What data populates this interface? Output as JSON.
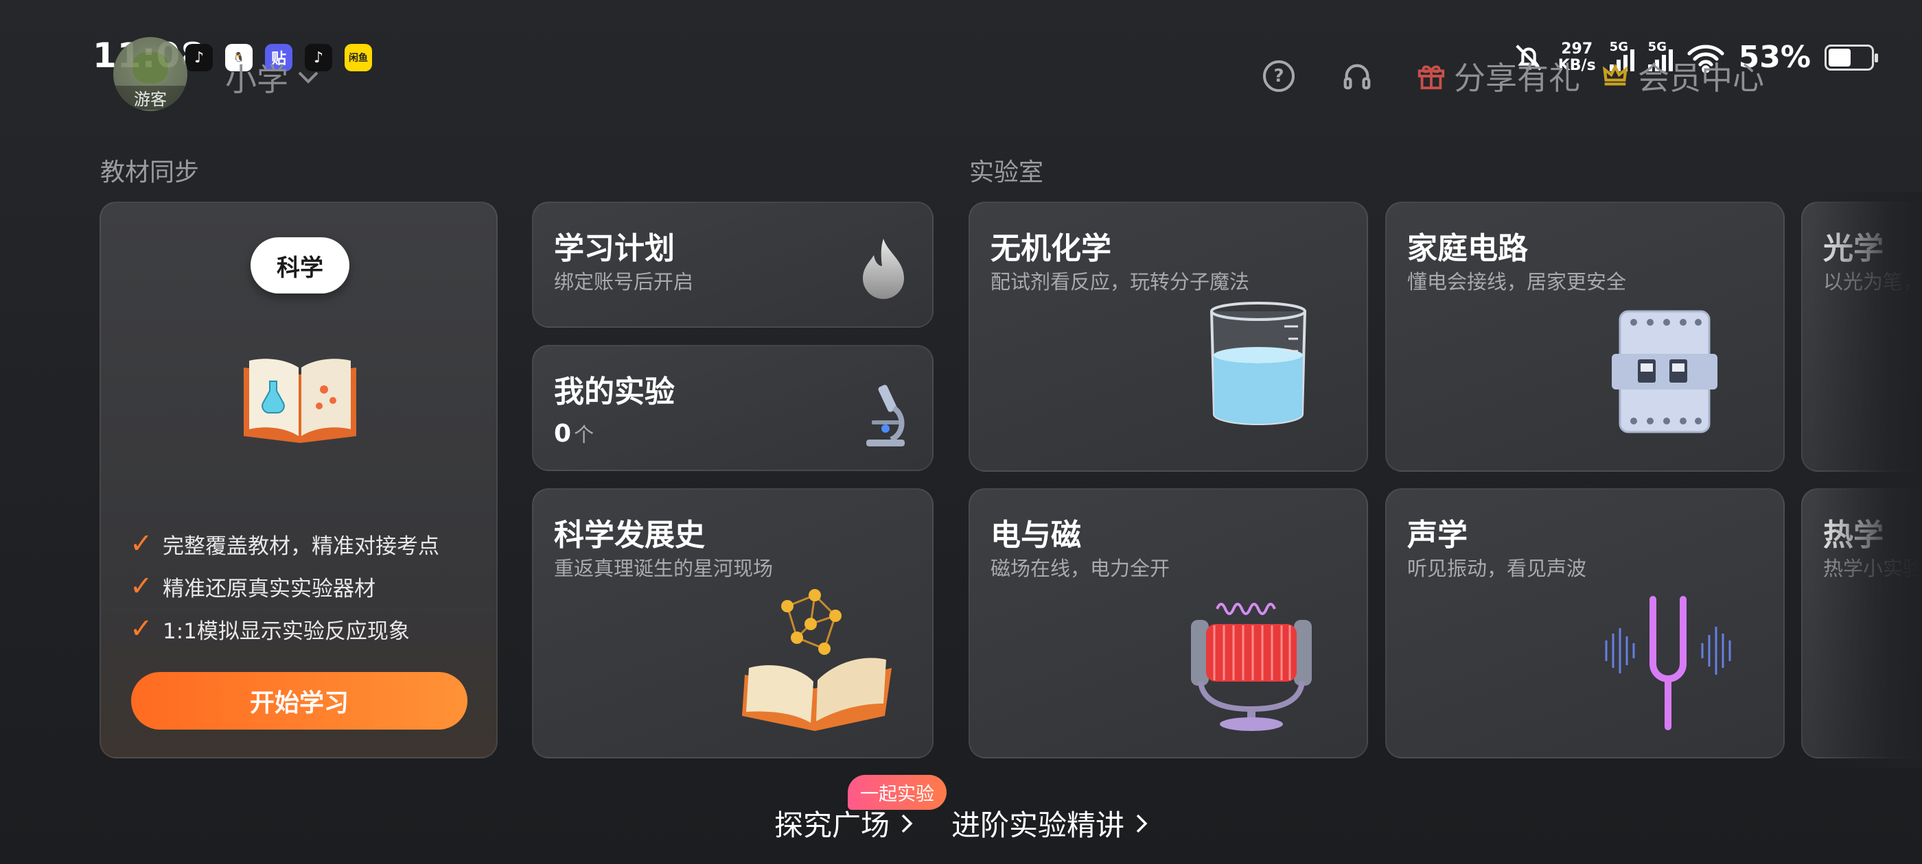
{
  "status_bar": {
    "time": "11:08",
    "apps": [
      {
        "name": "tiktok-icon",
        "glyph": "♪",
        "bg": "#111111",
        "fg": "#ffffff"
      },
      {
        "name": "qq-icon",
        "glyph": "🐧",
        "bg": "#ffffff",
        "fg": "#111111"
      },
      {
        "name": "tieba-icon",
        "glyph": "贴",
        "bg": "#5b5ff0",
        "fg": "#ffffff"
      },
      {
        "name": "tiktok-icon-2",
        "glyph": "♪",
        "bg": "#111111",
        "fg": "#ffffff"
      },
      {
        "name": "mini-app-icon",
        "glyph": "闲鱼",
        "bg": "#ffd900",
        "fg": "#222222"
      }
    ],
    "net_speed_value": "297",
    "net_speed_unit": "KB/s",
    "signal_1": "5G",
    "signal_2": "5G",
    "battery_percent": "53%",
    "battery_level": 0.53
  },
  "header": {
    "guest_label": "游客",
    "grade_label": "小学",
    "share_label": "分享有礼",
    "vip_label": "会员中心"
  },
  "sections": {
    "textbook_title": "教材同步",
    "lab_title": "实验室"
  },
  "textbook_card": {
    "subject": "科学",
    "features": [
      "完整覆盖教材，精准对接考点",
      "精准还原真实实验器材",
      "1:1模拟显示实验反应现象"
    ],
    "start_button": "开始学习"
  },
  "plan_card": {
    "title": "学习计划",
    "subtitle": "绑定账号后开启"
  },
  "my_experiments_card": {
    "title": "我的实验",
    "count": "0",
    "unit": "个"
  },
  "history_card": {
    "title": "科学发展史",
    "subtitle": "重返真理诞生的星河现场"
  },
  "lab_cards": {
    "inorganic": {
      "title": "无机化学",
      "subtitle": "配试剂看反应，玩转分子魔法"
    },
    "circuit": {
      "title": "家庭电路",
      "subtitle": "懂电会接线，居家更安全"
    },
    "optics": {
      "title": "光学",
      "subtitle": "以光为笔，"
    },
    "emag": {
      "title": "电与磁",
      "subtitle": "磁场在线，电力全开"
    },
    "acoustics": {
      "title": "声学",
      "subtitle": "听见振动，看见声波"
    },
    "heat": {
      "title": "热学",
      "subtitle": "热学小实验"
    }
  },
  "bottom": {
    "badge": "一起实验",
    "plaza": "探究广场",
    "advanced": "进阶实验精讲"
  },
  "colors": {
    "accent_orange": "#ff7a2a",
    "badge_pink": "#ff5a8a",
    "background": "#222428"
  }
}
